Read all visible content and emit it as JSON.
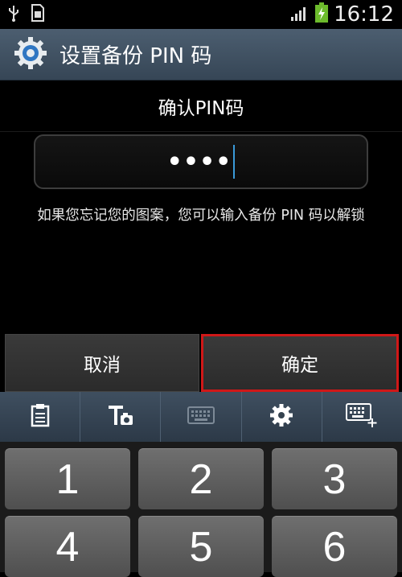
{
  "status_bar": {
    "time": "16:12",
    "icons": [
      "usb-icon",
      "sim-icon",
      "signal-icon",
      "battery-charging-icon"
    ]
  },
  "title_bar": {
    "icon": "settings-gear-icon",
    "title": "设置备份 PIN 码"
  },
  "header": {
    "label": "确认PIN码"
  },
  "pin_field": {
    "value": "••••"
  },
  "hint": {
    "text": "如果您忘记您的图案，您可以输入备份 PIN 码以解锁"
  },
  "buttons": {
    "cancel_label": "取消",
    "confirm_label": "确定"
  },
  "keyboard_toolbar": {
    "tools": [
      "clipboard-icon",
      "handwriting-icon",
      "keyboard-icon",
      "settings-icon",
      "keyboard-resize-icon"
    ]
  },
  "keypad": {
    "keys": [
      "1",
      "2",
      "3",
      "4",
      "5",
      "6"
    ]
  },
  "colors": {
    "title_bar": "#3f4f60",
    "highlight": "#d01818",
    "cursor": "#3a9ad9"
  }
}
